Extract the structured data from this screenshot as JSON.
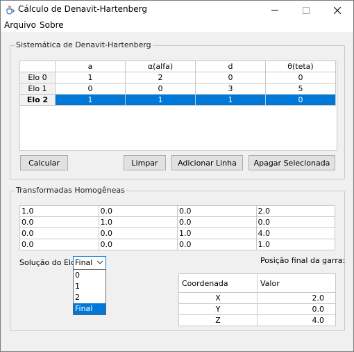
{
  "window": {
    "title": "Cálculo de Denavit-Hartenberg"
  },
  "menu": {
    "items": [
      "Arquivo",
      "Sobre"
    ]
  },
  "dh_group": {
    "title": "Sistemática de Denavit-Hartenberg",
    "columns": [
      "",
      "a",
      "α(alfa)",
      "d",
      "θ(teta)"
    ],
    "rows": [
      {
        "label": "Elo 0",
        "cells": [
          "1",
          "2",
          "0",
          "0"
        ]
      },
      {
        "label": "Elo 1",
        "cells": [
          "0",
          "0",
          "3",
          "5"
        ]
      },
      {
        "label": "Elo 2",
        "cells": [
          "1",
          "1",
          "1",
          "0"
        ]
      }
    ],
    "selected_row": "Elo 2",
    "buttons": [
      "Calcular",
      "Limpar",
      "Adicionar Linha",
      "Apagar Selecionada"
    ]
  },
  "transform_group": {
    "title": "Transformadas Homogêneas",
    "matrix": [
      [
        "1.0",
        "0.0",
        "0.0",
        "2.0"
      ],
      [
        "0.0",
        "1.0",
        "0.0",
        "0.0"
      ],
      [
        "0.0",
        "0.0",
        "1.0",
        "4.0"
      ],
      [
        "0.0",
        "0.0",
        "0.0",
        "1.0"
      ]
    ],
    "solution_label": "Solução do Elo:",
    "solution_value": "Final",
    "solution_options": [
      "0",
      "1",
      "2",
      "Final"
    ],
    "position_label": "Posição final da garra:",
    "result_columns": [
      "Coordenada",
      "Valor"
    ],
    "results": [
      {
        "coord": "X",
        "value": "2.0"
      },
      {
        "coord": "Y",
        "value": "0.0"
      },
      {
        "coord": "Z",
        "value": "4.0"
      }
    ]
  },
  "colors": {
    "selection": "#0078d7",
    "background": "#f0f0f0",
    "border": "#c8c8c8"
  },
  "icons": {
    "app": "java-cup-icon",
    "minimize": "minimize-icon",
    "maximize": "maximize-icon",
    "close": "close-icon",
    "dropdown": "chevron-down-icon"
  }
}
